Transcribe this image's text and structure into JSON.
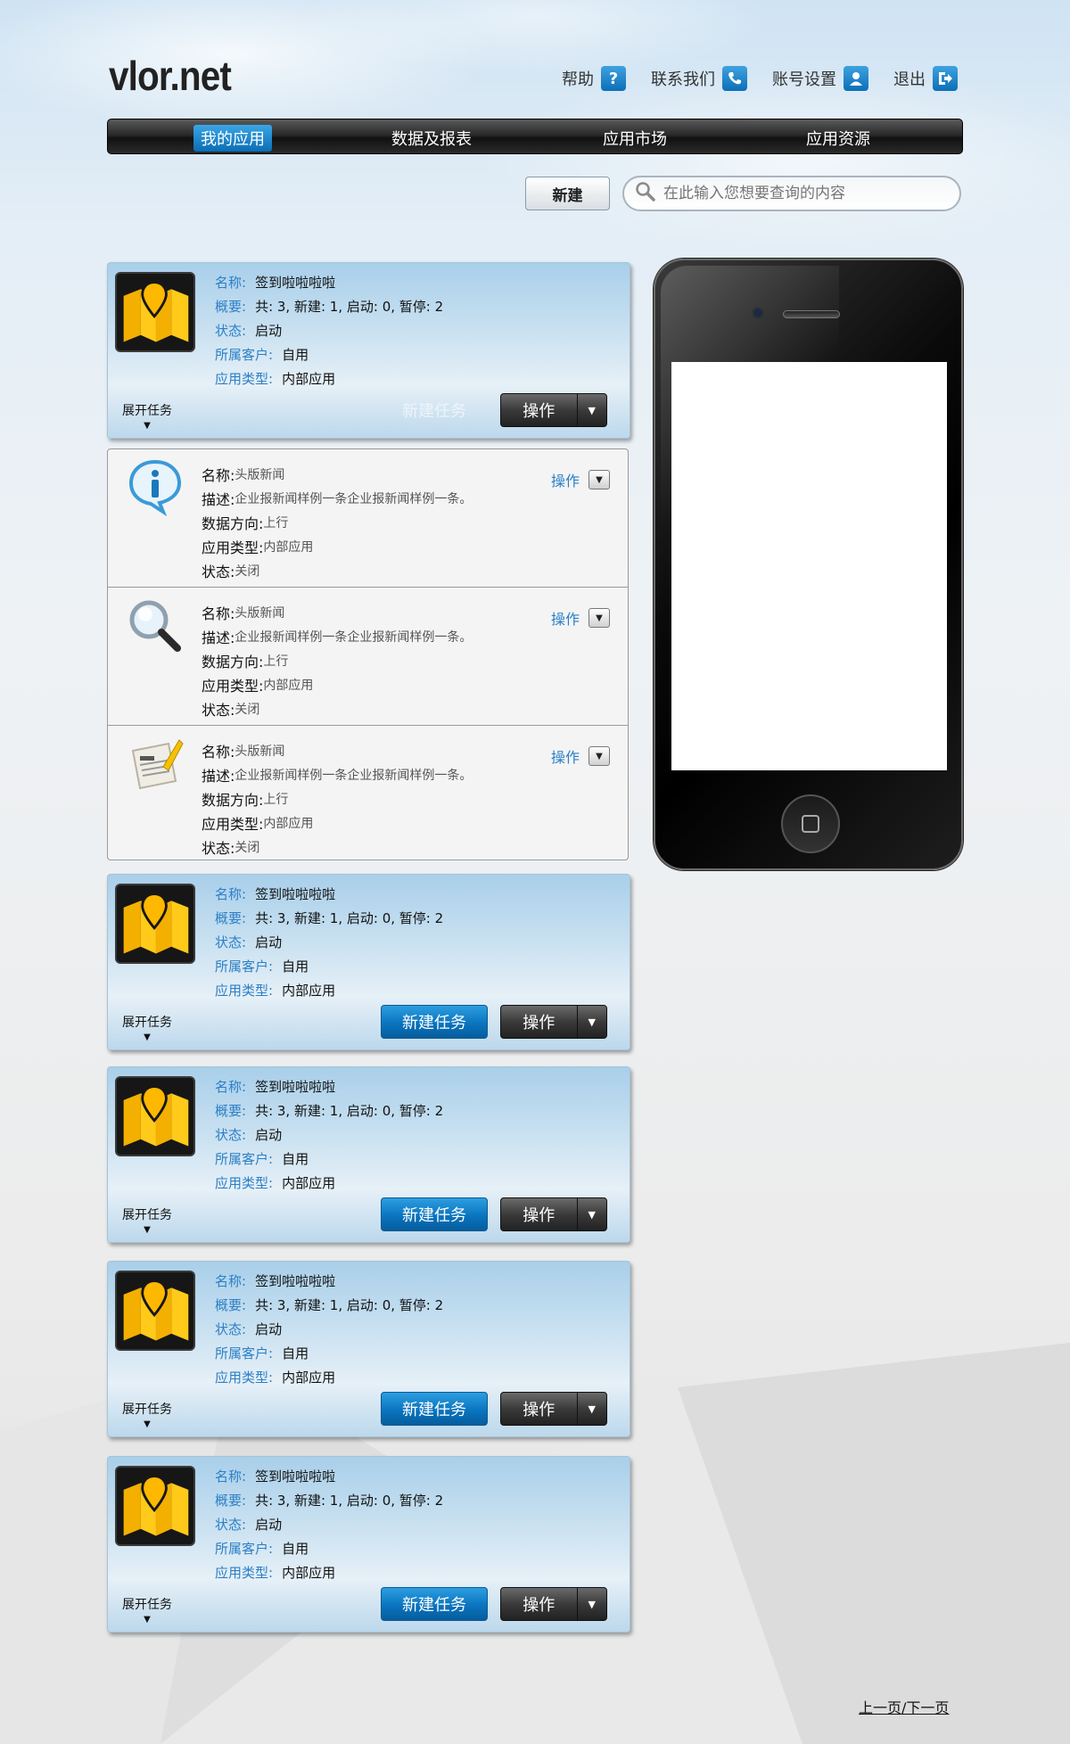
{
  "logo": "vlor.net",
  "top_links": [
    {
      "label": "帮助",
      "icon": "help-icon",
      "glyph": "?"
    },
    {
      "label": "联系我们",
      "icon": "phone-icon",
      "glyph": "✆"
    },
    {
      "label": "账号设置",
      "icon": "user-icon",
      "glyph": "👤"
    },
    {
      "label": "退出",
      "icon": "logout-icon",
      "glyph": "⇥"
    }
  ],
  "nav": {
    "items": [
      "我的应用",
      "数据及报表",
      "应用市场",
      "应用资源"
    ],
    "active": "我的应用"
  },
  "toolbar": {
    "new_label": "新建",
    "search_placeholder": "在此输入您想要查询的内容"
  },
  "labels": {
    "name": "名称:",
    "summary": "概要:",
    "status": "状态:",
    "customer": "所属客户:",
    "app_type": "应用类型:",
    "expand": "展开任务",
    "new_task": "新建任务",
    "operate": "操作",
    "news_name": "名称:",
    "news_desc": "描述:",
    "news_direction": "数据方向:",
    "news_type": "应用类型:",
    "news_status": "状态:"
  },
  "apps": [
    {
      "name": "签到啦啦啦啦",
      "summary": "共: 3, 新建: 1, 启动: 0, 暂停: 2",
      "status": "启动",
      "customer": "自用",
      "type": "内部应用"
    },
    {
      "name": "签到啦啦啦啦",
      "summary": "共: 3, 新建: 1, 启动: 0, 暂停: 2",
      "status": "启动",
      "customer": "自用",
      "type": "内部应用"
    },
    {
      "name": "签到啦啦啦啦",
      "summary": "共: 3, 新建: 1, 启动: 0, 暂停: 2",
      "status": "启动",
      "customer": "自用",
      "type": "内部应用"
    },
    {
      "name": "签到啦啦啦啦",
      "summary": "共: 3, 新建: 1, 启动: 0, 暂停: 2",
      "status": "启动",
      "customer": "自用",
      "type": "内部应用"
    },
    {
      "name": "签到啦啦啦啦",
      "summary": "共: 3, 新建: 1, 启动: 0, 暂停: 2",
      "status": "启动",
      "customer": "自用",
      "type": "内部应用"
    }
  ],
  "news": [
    {
      "icon": "info-icon",
      "name": "头版新闻",
      "desc": "企业报新闻样例一条企业报新闻样例一条。",
      "direction": "上行",
      "type": "内部应用",
      "status": "关闭",
      "op": "操作"
    },
    {
      "icon": "magnifier-icon",
      "name": "头版新闻",
      "desc": "企业报新闻样例一条企业报新闻样例一条。",
      "direction": "上行",
      "type": "内部应用",
      "status": "关闭",
      "op": "操作"
    },
    {
      "icon": "blog-icon",
      "name": "头版新闻",
      "desc": "企业报新闻样例一条企业报新闻样例一条。",
      "direction": "上行",
      "type": "内部应用",
      "status": "关闭",
      "op": "操作"
    }
  ],
  "pager": "上一页/下一页",
  "colors": {
    "accent": "#0b74bf",
    "label_blue": "#2b7fc6",
    "nav_dark": "#1c1c1c"
  }
}
